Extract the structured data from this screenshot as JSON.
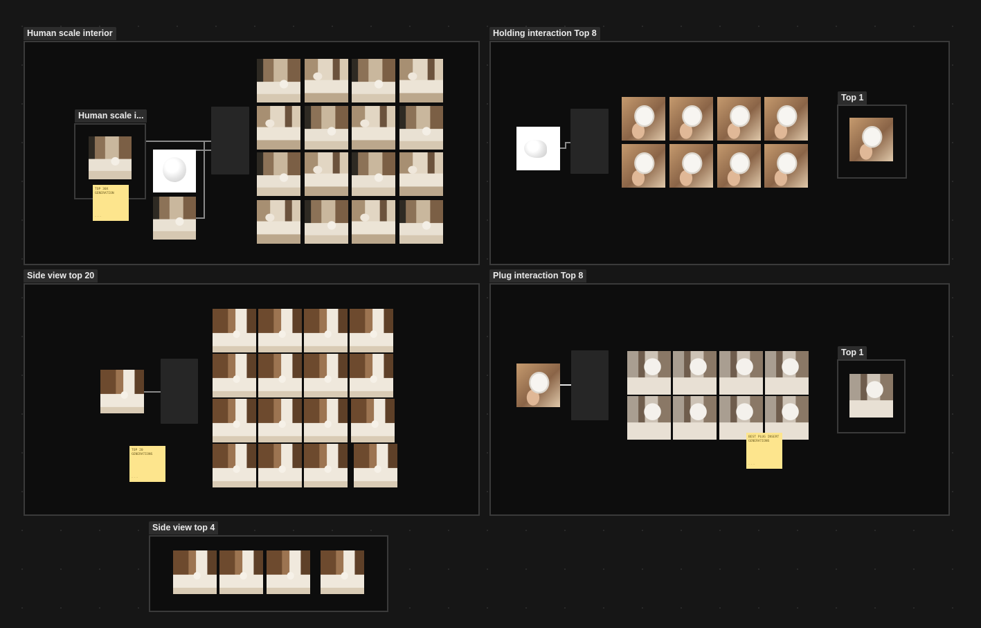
{
  "frames": {
    "human_scale": {
      "label": "Human scale interior",
      "subframe_label": "Human scale i...",
      "sticky_text": "TOP 30X GENERATION",
      "sticky_author": ""
    },
    "holding": {
      "label": "Holding interaction Top 8",
      "top1_label": "Top 1"
    },
    "side20": {
      "label": "Side view top 20",
      "sticky_text": "TOP 20 GENERATIONS"
    },
    "plug": {
      "label": "Plug interaction Top 8",
      "top1_label": "Top 1",
      "sticky_text": "BEST PLUG INSERT GENERATIONS"
    },
    "side4": {
      "label": "Side view top 4"
    }
  },
  "colors": {
    "canvas": "#161616",
    "frame_fill": "#0d0d0d",
    "frame_border": "#3a3a3a",
    "label_bg": "#2d2d2d",
    "sticky": "#fde58d"
  },
  "icons": {
    "product": "white-lamp-product-image",
    "generation": "generated-interior-image"
  }
}
